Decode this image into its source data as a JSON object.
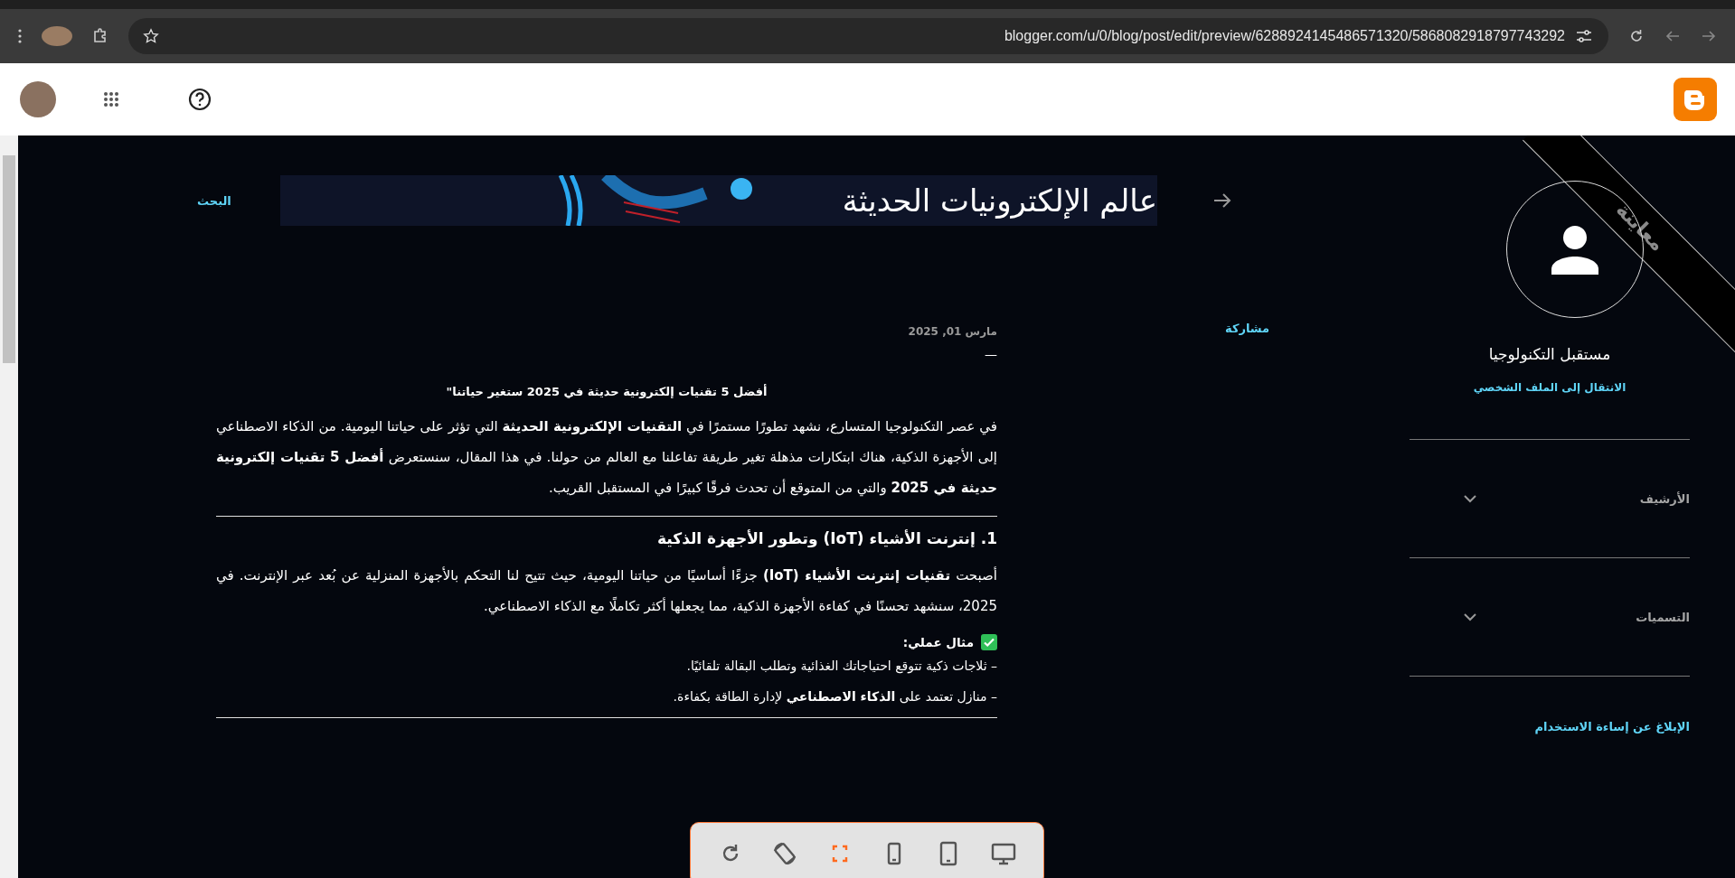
{
  "browser": {
    "url": "blogger.com/u/0/blog/post/edit/preview/6288924145486571320/5868082918797743292"
  },
  "blog": {
    "search_label": "البحث",
    "title": "عالم الإلكترونيات الحديثة"
  },
  "post": {
    "share_label": "مشاركة",
    "date": "مارس 01, 2025",
    "dash": "—",
    "title": "أفضل 5 تقنيات إلكترونية حديثة في 2025 ستغير حياتنا\"",
    "blocks": [
      {
        "kind": "paragraph",
        "text": "في عصر التكنولوجيا المتسارع، نشهد تطورًا مستمرًا في **التقنيات الإلكترونية الحديثة** التي تؤثر على حياتنا اليومية. من الذكاء الاصطناعي إلى الأجهزة الذكية، هناك ابتكارات مذهلة تغير طريقة تفاعلنا مع العالم من حولنا. في هذا المقال، سنستعرض **أفضل 5 تقنيات إلكترونية حديثة في 2025** والتي من المتوقع أن تحدث فرقًا كبيرًا في المستقبل القريب."
      },
      {
        "kind": "rule"
      },
      {
        "kind": "heading",
        "text": "1. إنترنت الأشياء (IoT) وتطور الأجهزة الذكية"
      },
      {
        "kind": "paragraph",
        "text": "أصبحت **تقنيات إنترنت الأشياء (IoT)** جزءًا أساسيًا من حياتنا اليومية، حيث تتيح لنا التحكم بالأجهزة المنزلية عن بُعد عبر الإنترنت. في 2025، سنشهد تحسنًا في كفاءة الأجهزة الذكية، مما يجعلها أكثر تكاملًا مع الذكاء الاصطناعي."
      },
      {
        "kind": "example",
        "text": "مثال عملي:"
      },
      {
        "kind": "bullet",
        "text": "– ثلاجات ذكية تتوقع احتياجاتك الغذائية وتطلب البقالة تلقائيًا."
      },
      {
        "kind": "bullet",
        "text": "– منازل تعتمد على **الذكاء الاصطناعي** لإدارة الطاقة بكفاءة."
      },
      {
        "kind": "rule"
      }
    ]
  },
  "sidebar": {
    "ribbon": "معاينة",
    "profile_name": "مستقبل التكنولوجيا",
    "profile_link": "الانتقال إلى الملف الشخصي",
    "sections": [
      {
        "label": "الأرشيف",
        "expanded": false
      },
      {
        "label": "التسميات",
        "expanded": false
      }
    ],
    "report_link": "الإبلاغ عن إساءة الاستخدام"
  },
  "device_toolbar": [
    {
      "kind": "reload",
      "selected": false
    },
    {
      "kind": "rotate",
      "selected": false
    },
    {
      "kind": "fullscreen",
      "selected": true
    },
    {
      "kind": "phone",
      "selected": false
    },
    {
      "kind": "tablet",
      "selected": false
    },
    {
      "kind": "desktop",
      "selected": false
    }
  ]
}
